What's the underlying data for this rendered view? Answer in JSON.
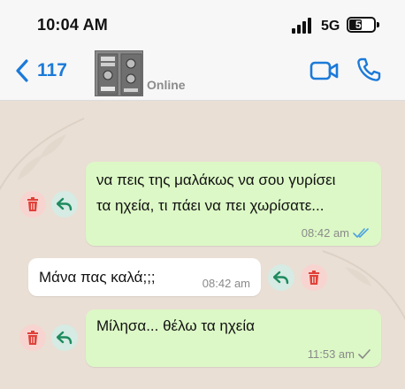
{
  "status_bar": {
    "time": "10:04 AM",
    "network": "5G",
    "battery_level": "50",
    "battery_fraction": 0.5
  },
  "header": {
    "back_count": "117",
    "contact_status": "Online",
    "accent_color": "#1b7ad9",
    "icons": [
      "chevron-left-icon",
      "video-camera-icon",
      "phone-icon"
    ]
  },
  "messages": [
    {
      "direction": "outgoing",
      "lines": [
        "να πεις της μαλάκως να σου γυρίσει",
        "τα ηχεία, τι πάει να πει χωρίσατε..."
      ],
      "time": "08:42 am",
      "status": "read",
      "tick_color": "#4fa3e0"
    },
    {
      "direction": "incoming",
      "text": "Μάνα πας καλά;;;",
      "time": "08:42 am"
    },
    {
      "direction": "outgoing",
      "text": "Μίλησα... θέλω τα ηχεία",
      "time": "11:53 am",
      "status": "sent",
      "tick_color": "#8a8a8a"
    }
  ],
  "actions": {
    "delete_icon": "trash-icon",
    "reply_icon": "reply-icon",
    "delete_color": "#e0413a",
    "reply_color": "#1e8a5e"
  },
  "colors": {
    "outgoing_bubble": "#dcf8c6",
    "incoming_bubble": "#ffffff",
    "chat_background": "#e9dfd5"
  }
}
